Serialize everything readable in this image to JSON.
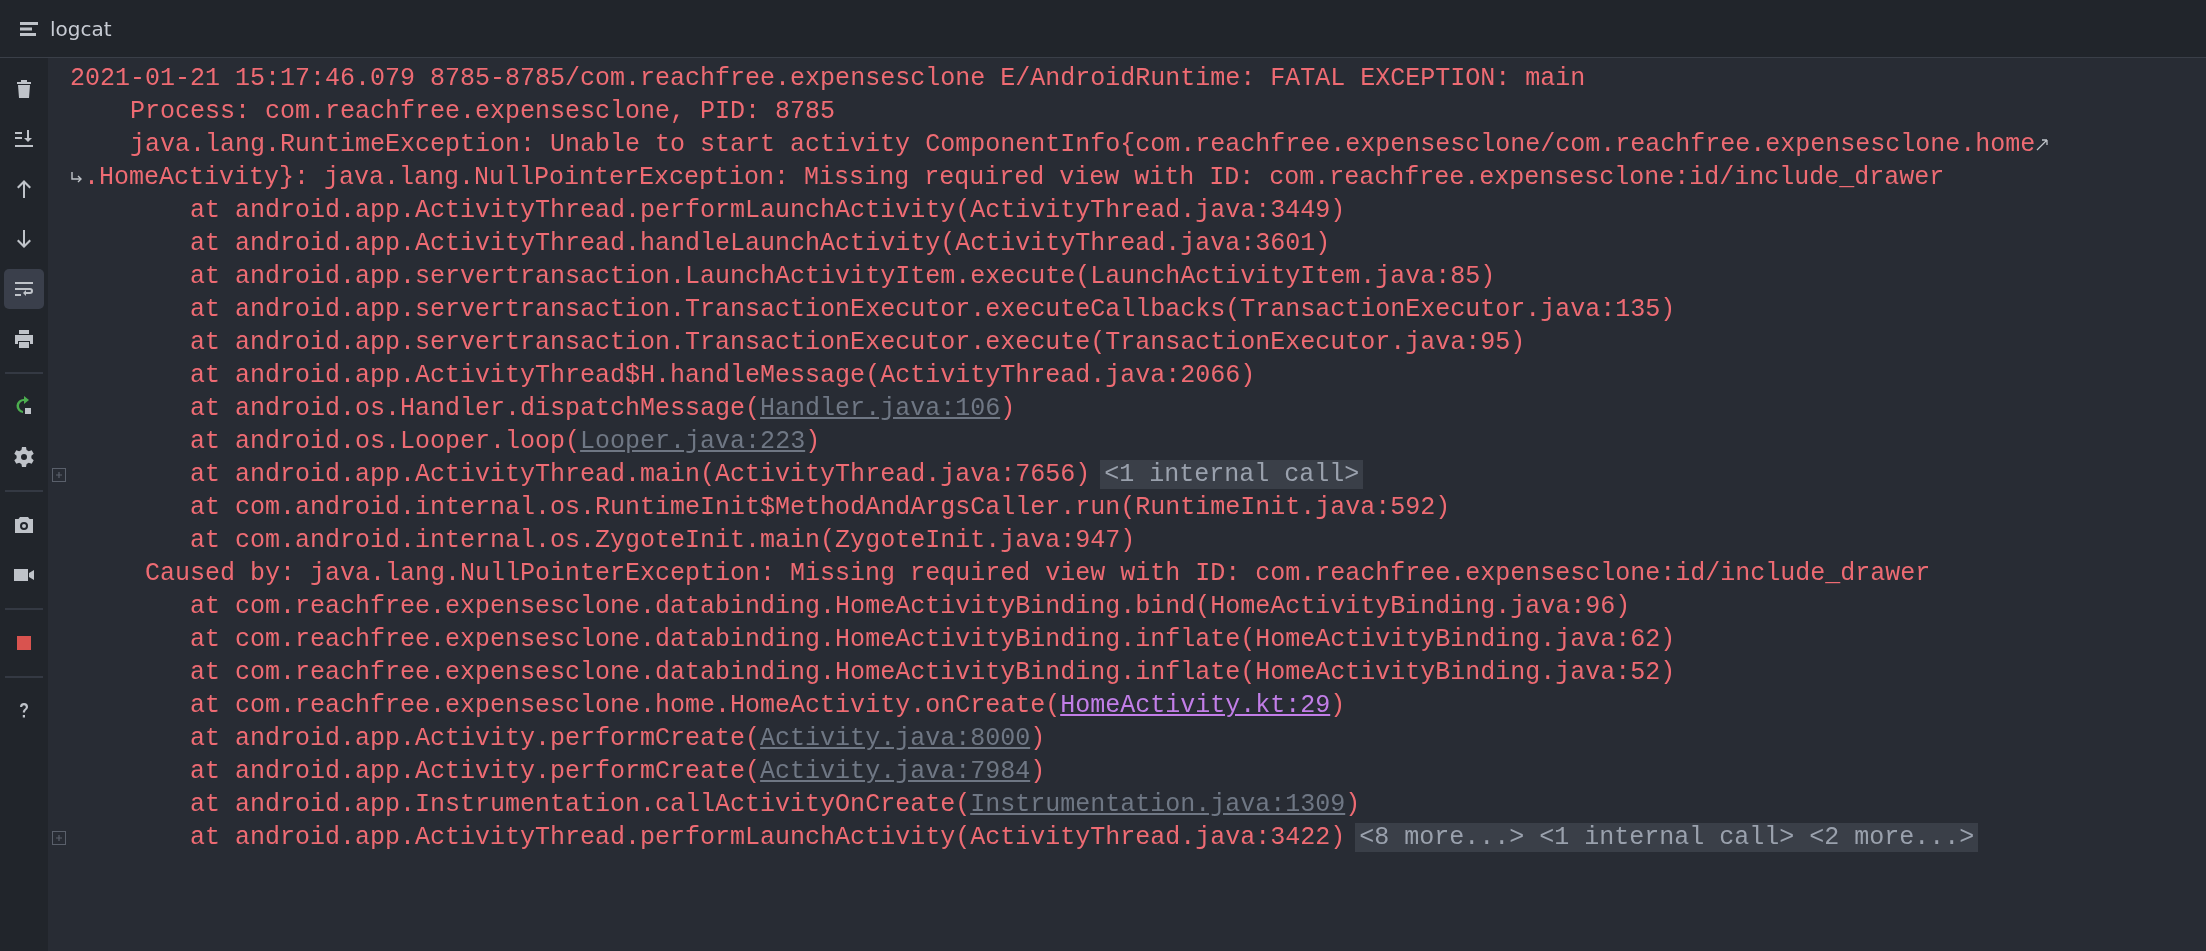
{
  "window": {
    "title": "logcat"
  },
  "toolbar": [
    {
      "kind": "button",
      "selected": false
    },
    {
      "kind": "button",
      "selected": false
    },
    {
      "kind": "button",
      "selected": false
    },
    {
      "kind": "button",
      "selected": false
    },
    {
      "kind": "button",
      "selected": true
    },
    {
      "kind": "button",
      "selected": false
    },
    {
      "kind": "separator"
    },
    {
      "kind": "button",
      "selected": false
    },
    {
      "kind": "button",
      "selected": false
    },
    {
      "kind": "separator"
    },
    {
      "kind": "button",
      "selected": false
    },
    {
      "kind": "button",
      "selected": false
    },
    {
      "kind": "separator"
    },
    {
      "kind": "button",
      "selected": false
    },
    {
      "kind": "separator"
    },
    {
      "kind": "button",
      "selected": false
    }
  ],
  "log_lines": [
    {
      "kind": "header",
      "foldable": false,
      "wraps": false,
      "segments": [
        {
          "kind": "text",
          "text": "2021-01-21 15:17:46.079 8785-8785/com.reachfree.expensesclone E/AndroidRuntime: FATAL EXCEPTION: main"
        }
      ]
    },
    {
      "kind": "detail",
      "foldable": false,
      "wraps": false,
      "segments": [
        {
          "kind": "text",
          "text": "Process: com.reachfree.expensesclone, PID: 8785"
        }
      ]
    },
    {
      "kind": "detail",
      "foldable": false,
      "wraps": true,
      "segments": [
        {
          "kind": "text",
          "text": "java.lang.RuntimeException: Unable to start activity ComponentInfo{com.reachfree.expensesclone/com.reachfree.expensesclone.home"
        }
      ]
    },
    {
      "kind": "continuation",
      "foldable": false,
      "wraps": false,
      "segments": [
        {
          "kind": "text",
          "text": ".HomeActivity}: java.lang.NullPointerException: Missing required view with ID: com.reachfree.expensesclone:id/include_drawer"
        }
      ]
    },
    {
      "kind": "frame",
      "foldable": false,
      "wraps": false,
      "segments": [
        {
          "kind": "text",
          "text": "at android.app.ActivityThread.performLaunchActivity(ActivityThread.java:3449)"
        }
      ]
    },
    {
      "kind": "frame",
      "foldable": false,
      "wraps": false,
      "segments": [
        {
          "kind": "text",
          "text": "at android.app.ActivityThread.handleLaunchActivity(ActivityThread.java:3601)"
        }
      ]
    },
    {
      "kind": "frame",
      "foldable": false,
      "wraps": false,
      "segments": [
        {
          "kind": "text",
          "text": "at android.app.servertransaction.LaunchActivityItem.execute(LaunchActivityItem.java:85)"
        }
      ]
    },
    {
      "kind": "frame",
      "foldable": false,
      "wraps": false,
      "segments": [
        {
          "kind": "text",
          "text": "at android.app.servertransaction.TransactionExecutor.executeCallbacks(TransactionExecutor.java:135)"
        }
      ]
    },
    {
      "kind": "frame",
      "foldable": false,
      "wraps": false,
      "segments": [
        {
          "kind": "text",
          "text": "at android.app.servertransaction.TransactionExecutor.execute(TransactionExecutor.java:95)"
        }
      ]
    },
    {
      "kind": "frame",
      "foldable": false,
      "wraps": false,
      "segments": [
        {
          "kind": "text",
          "text": "at android.app.ActivityThread$H.handleMessage(ActivityThread.java:2066)"
        }
      ]
    },
    {
      "kind": "frame",
      "foldable": false,
      "wraps": false,
      "segments": [
        {
          "kind": "text",
          "text": "at android.os.Handler.dispatchMessage("
        },
        {
          "kind": "link",
          "text": "Handler.java:106"
        },
        {
          "kind": "text",
          "text": ")"
        }
      ]
    },
    {
      "kind": "frame",
      "foldable": false,
      "wraps": false,
      "segments": [
        {
          "kind": "text",
          "text": "at android.os.Looper.loop("
        },
        {
          "kind": "link",
          "text": "Looper.java:223"
        },
        {
          "kind": "text",
          "text": ")"
        }
      ]
    },
    {
      "kind": "frame",
      "foldable": true,
      "wraps": false,
      "segments": [
        {
          "kind": "text",
          "text": "at android.app.ActivityThread.main(ActivityThread.java:7656)"
        },
        {
          "kind": "fold",
          "text": "<1 internal call>"
        }
      ]
    },
    {
      "kind": "frame",
      "foldable": false,
      "wraps": false,
      "segments": [
        {
          "kind": "text",
          "text": "at com.android.internal.os.RuntimeInit$MethodAndArgsCaller.run(RuntimeInit.java:592)"
        }
      ]
    },
    {
      "kind": "frame",
      "foldable": false,
      "wraps": false,
      "segments": [
        {
          "kind": "text",
          "text": "at com.android.internal.os.ZygoteInit.main(ZygoteInit.java:947)"
        }
      ]
    },
    {
      "kind": "cause",
      "foldable": false,
      "wraps": false,
      "segments": [
        {
          "kind": "text",
          "text": "Caused by: java.lang.NullPointerException: Missing required view with ID: com.reachfree.expensesclone:id/include_drawer"
        }
      ]
    },
    {
      "kind": "frame",
      "foldable": false,
      "wraps": false,
      "segments": [
        {
          "kind": "text",
          "text": "at com.reachfree.expensesclone.databinding.HomeActivityBinding.bind(HomeActivityBinding.java:96)"
        }
      ]
    },
    {
      "kind": "frame",
      "foldable": false,
      "wraps": false,
      "segments": [
        {
          "kind": "text",
          "text": "at com.reachfree.expensesclone.databinding.HomeActivityBinding.inflate(HomeActivityBinding.java:62)"
        }
      ]
    },
    {
      "kind": "frame",
      "foldable": false,
      "wraps": false,
      "segments": [
        {
          "kind": "text",
          "text": "at com.reachfree.expensesclone.databinding.HomeActivityBinding.inflate(HomeActivityBinding.java:52)"
        }
      ]
    },
    {
      "kind": "frame",
      "foldable": false,
      "wraps": false,
      "segments": [
        {
          "kind": "text",
          "text": "at com.reachfree.expensesclone.home.HomeActivity.onCreate("
        },
        {
          "kind": "source-link",
          "text": "HomeActivity.kt:29"
        },
        {
          "kind": "text",
          "text": ")"
        }
      ]
    },
    {
      "kind": "frame",
      "foldable": false,
      "wraps": false,
      "segments": [
        {
          "kind": "text",
          "text": "at android.app.Activity.performCreate("
        },
        {
          "kind": "link",
          "text": "Activity.java:8000"
        },
        {
          "kind": "text",
          "text": ")"
        }
      ]
    },
    {
      "kind": "frame",
      "foldable": false,
      "wraps": false,
      "segments": [
        {
          "kind": "text",
          "text": "at android.app.Activity.performCreate("
        },
        {
          "kind": "link",
          "text": "Activity.java:7984"
        },
        {
          "kind": "text",
          "text": ")"
        }
      ]
    },
    {
      "kind": "frame",
      "foldable": false,
      "wraps": false,
      "segments": [
        {
          "kind": "text",
          "text": "at android.app.Instrumentation.callActivityOnCreate("
        },
        {
          "kind": "link",
          "text": "Instrumentation.java:1309"
        },
        {
          "kind": "text",
          "text": ")"
        }
      ]
    },
    {
      "kind": "frame",
      "foldable": true,
      "wraps": false,
      "segments": [
        {
          "kind": "text",
          "text": "at android.app.ActivityThread.performLaunchActivity(ActivityThread.java:3422)"
        },
        {
          "kind": "fold",
          "text": "<8 more...> <1 internal call> <2 more...>"
        }
      ]
    }
  ]
}
